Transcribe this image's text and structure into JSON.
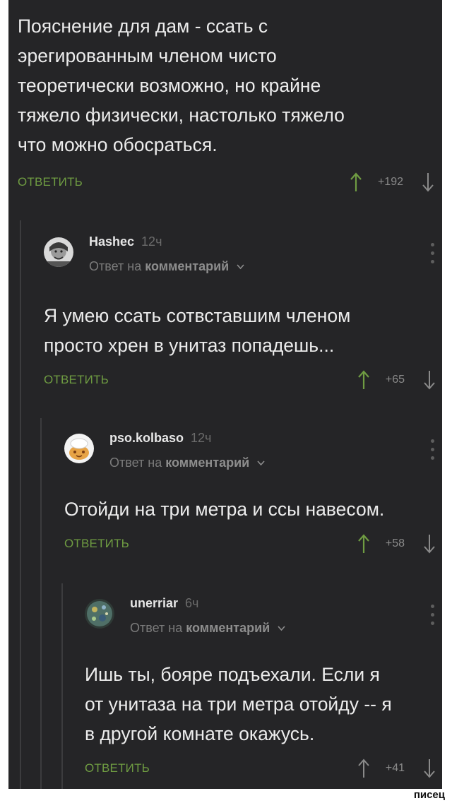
{
  "root": {
    "text_lines": [
      "Пояснение для дам - ссать с",
      "эрегированным членом чисто",
      "теоретически возможно, но крайне",
      "тяжело физически, настолько тяжело",
      "что можно обосраться."
    ],
    "reply_label": "ОТВЕТИТЬ",
    "score": "+192"
  },
  "comments": [
    {
      "user": "Hashec",
      "time": "12ч",
      "reply_prefix": "Ответ на",
      "reply_target": "комментарий",
      "text_lines": [
        "Я умею ссать сотвставшим членом",
        "просто хрен в унитаз попадешь..."
      ],
      "reply_label": "ОТВЕТИТЬ",
      "score": "+65"
    },
    {
      "user": "pso.kolbaso",
      "time": "12ч",
      "reply_prefix": "Ответ на",
      "reply_target": "комментарий",
      "text_lines": [
        "Отойди на три метра и ссы навесом."
      ],
      "reply_label": "ОТВЕТИТЬ",
      "score": "+58"
    },
    {
      "user": "unerriar",
      "time": "6ч",
      "reply_prefix": "Ответ на",
      "reply_target": "комментарий",
      "text_lines": [
        "Ишь ты, бояре подъехали. Если я",
        "от унитаза на три метра отойду -- я",
        "в другой комнате окажусь."
      ],
      "reply_label": "ОТВЕТИТЬ",
      "score": "+41"
    }
  ],
  "watermark": "писец",
  "colors": {
    "background": "#252527",
    "text": "#ececec",
    "reply_green": "#6f9c42",
    "thread_line": "#3c3c3e"
  },
  "icons": [
    "arrow-up-icon",
    "arrow-down-icon",
    "more-vertical-icon",
    "chevron-down-icon",
    "avatar"
  ]
}
